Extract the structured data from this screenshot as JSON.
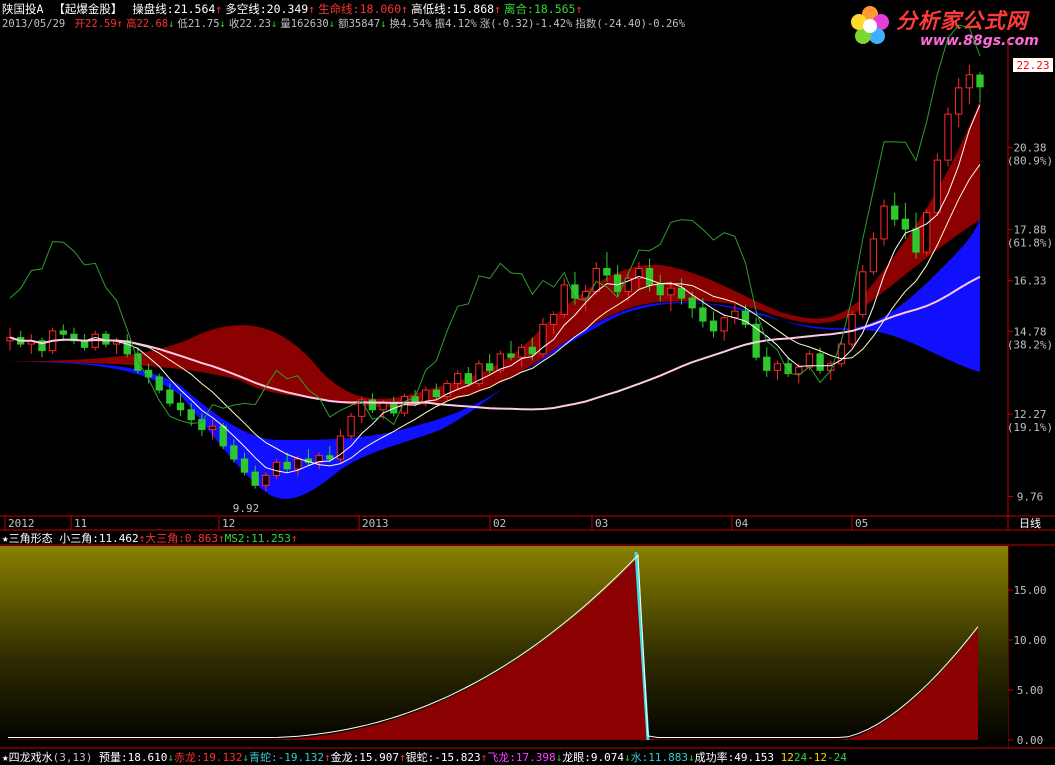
{
  "main_header": {
    "stock": "陕国投A",
    "formula": "【起爆金股】",
    "items": [
      {
        "label": "操盘线",
        "value": "21.564",
        "arrow": "↑",
        "color": "#ffffff"
      },
      {
        "label": "多空线",
        "value": "20.349",
        "arrow": "↑",
        "color": "#ffffff"
      },
      {
        "label": "生命线",
        "value": "18.060",
        "arrow": "↑",
        "color": "#ff3030"
      },
      {
        "label": "高低线",
        "value": "15.868",
        "arrow": "↑",
        "color": "#ffffff"
      },
      {
        "label": "离合",
        "value": "18.565",
        "arrow": "↑",
        "color": "#38d438"
      }
    ]
  },
  "quote_line": {
    "date": "2013/05/29",
    "items": [
      {
        "label": "开",
        "value": "22.59",
        "arrow": "↑",
        "color": "#ff3030"
      },
      {
        "label": "高",
        "value": "22.68",
        "arrow": "↓",
        "color": "#ff3030"
      },
      {
        "label": "低",
        "value": "21.75",
        "arrow": "↓",
        "color": "#c0c0c0"
      },
      {
        "label": "收",
        "value": "22.23",
        "arrow": "↓",
        "color": "#c0c0c0"
      },
      {
        "label": "量",
        "value": "162630",
        "arrow": "↓",
        "color": "#c0c0c0"
      },
      {
        "label": "额",
        "value": "35847",
        "arrow": "↓",
        "color": "#c0c0c0"
      },
      {
        "label": "换",
        "value": "4.54%",
        "arrow": "",
        "color": "#c0c0c0"
      },
      {
        "label": "振",
        "value": "4.12%",
        "arrow": "",
        "color": "#c0c0c0"
      },
      {
        "label": "涨",
        "value": "(-0.32)-1.42%",
        "arrow": "",
        "color": "#c0c0c0"
      },
      {
        "label": "指数",
        "value": "(-24.40)-0.26%",
        "arrow": "",
        "color": "#c0c0c0"
      }
    ]
  },
  "logo": {
    "title": "分析家公式网",
    "url": "www.88gs.com"
  },
  "price_axis": {
    "current": "22.23",
    "ticks": [
      {
        "value": "20.38",
        "pct": "(80.9%)"
      },
      {
        "value": "17.88",
        "pct": "(61.8%)"
      },
      {
        "value": "16.33",
        "pct": ""
      },
      {
        "value": "14.78",
        "pct": "(38.2%)"
      },
      {
        "value": "12.27",
        "pct": "(19.1%)"
      },
      {
        "value": "9.76",
        "pct": ""
      }
    ]
  },
  "low_label": "9.92",
  "date_axis": {
    "labels": [
      "2012",
      "11",
      "12",
      "2013",
      "02",
      "03",
      "04",
      "05"
    ],
    "period": "日线"
  },
  "sub1_header": {
    "title": "★三角形态",
    "items": [
      {
        "label": "小三角",
        "value": "11.462",
        "arrow": "↑",
        "color": "#ffffff"
      },
      {
        "label": "大三角",
        "value": "0.863",
        "arrow": "↑",
        "color": "#ff3030"
      },
      {
        "label": "MS2",
        "value": "11.253",
        "arrow": "↑",
        "color": "#38d438"
      }
    ],
    "ticks": [
      "15.00",
      "10.00",
      "5.00",
      "0.00"
    ]
  },
  "sub2_header": {
    "title": "★四龙戏水",
    "params": "(3,13)",
    "items": [
      {
        "label": "预量",
        "value": "18.610",
        "arrow": "↓",
        "color": "#ffffff"
      },
      {
        "label": "赤龙",
        "value": "19.132",
        "arrow": "↓",
        "color": "#ff3030"
      },
      {
        "label": "青蛇",
        "value": "-19.132",
        "arrow": "↑",
        "color": "#40c8c8"
      },
      {
        "label": "金龙",
        "value": "15.907",
        "arrow": "↑",
        "color": "#ffffff"
      },
      {
        "label": "银蛇",
        "value": "-15.823",
        "arrow": "↑",
        "color": "#ffffff"
      },
      {
        "label": "飞龙",
        "value": "17.398",
        "arrow": "↓",
        "color": "#ff40ff"
      },
      {
        "label": "龙眼",
        "value": "9.074",
        "arrow": "↓",
        "color": "#ffffff"
      },
      {
        "label": "水",
        "value": "11.883",
        "arrow": "↓",
        "color": "#40c8c8"
      },
      {
        "label": "成功率",
        "value": "49.153",
        "arrow": "",
        "color": "#ffffff"
      }
    ],
    "extra": [
      "12",
      "24",
      "-12",
      "-24"
    ]
  },
  "colors": {
    "up": "#ff2828",
    "down": "#2ec82e",
    "red_band": "#8b0000",
    "blue_band": "#1010ff",
    "axis": "#c00000",
    "pink_ma": "#ffc8e6",
    "green_line": "#2e9e2e",
    "yellow": "#ffd000"
  },
  "chart_data": {
    "type": "candlestick",
    "ylim": [
      9.5,
      23.2
    ],
    "dates": [
      "2012/10",
      "2012/11",
      "2012/12",
      "2013/01",
      "2013/02",
      "2013/03",
      "2013/04",
      "2013/05"
    ],
    "candles_ohlc": [
      [
        14.5,
        14.9,
        14.2,
        14.6
      ],
      [
        14.6,
        14.8,
        14.3,
        14.4
      ],
      [
        14.4,
        14.7,
        14.1,
        14.5
      ],
      [
        14.5,
        14.6,
        14.0,
        14.2
      ],
      [
        14.2,
        14.9,
        14.1,
        14.8
      ],
      [
        14.8,
        15.0,
        14.5,
        14.7
      ],
      [
        14.7,
        14.9,
        14.4,
        14.5
      ],
      [
        14.5,
        14.7,
        14.2,
        14.3
      ],
      [
        14.3,
        14.8,
        14.2,
        14.7
      ],
      [
        14.7,
        14.8,
        14.3,
        14.4
      ],
      [
        14.4,
        14.6,
        14.1,
        14.5
      ],
      [
        14.5,
        14.7,
        14.0,
        14.1
      ],
      [
        14.1,
        14.3,
        13.5,
        13.6
      ],
      [
        13.6,
        13.8,
        13.2,
        13.4
      ],
      [
        13.4,
        13.5,
        12.9,
        13.0
      ],
      [
        13.0,
        13.2,
        12.5,
        12.6
      ],
      [
        12.6,
        12.9,
        12.2,
        12.4
      ],
      [
        12.4,
        12.6,
        11.9,
        12.1
      ],
      [
        12.1,
        12.3,
        11.6,
        11.8
      ],
      [
        11.8,
        12.1,
        11.5,
        11.9
      ],
      [
        11.9,
        12.0,
        11.2,
        11.3
      ],
      [
        11.3,
        11.5,
        10.8,
        10.9
      ],
      [
        10.9,
        11.1,
        10.4,
        10.5
      ],
      [
        10.5,
        10.7,
        10.0,
        10.1
      ],
      [
        10.1,
        10.5,
        9.92,
        10.4
      ],
      [
        10.4,
        10.9,
        10.3,
        10.8
      ],
      [
        10.8,
        11.1,
        10.5,
        10.6
      ],
      [
        10.6,
        11.0,
        10.4,
        10.9
      ],
      [
        10.9,
        11.2,
        10.7,
        10.8
      ],
      [
        10.8,
        11.1,
        10.6,
        11.0
      ],
      [
        11.0,
        11.3,
        10.8,
        10.9
      ],
      [
        10.9,
        11.8,
        10.8,
        11.6
      ],
      [
        11.6,
        12.3,
        11.5,
        12.2
      ],
      [
        12.2,
        12.8,
        12.0,
        12.7
      ],
      [
        12.7,
        12.9,
        12.3,
        12.4
      ],
      [
        12.4,
        12.7,
        12.1,
        12.6
      ],
      [
        12.6,
        12.8,
        12.2,
        12.3
      ],
      [
        12.3,
        12.9,
        12.2,
        12.8
      ],
      [
        12.8,
        13.0,
        12.5,
        12.6
      ],
      [
        12.6,
        13.1,
        12.5,
        13.0
      ],
      [
        13.0,
        13.2,
        12.7,
        12.8
      ],
      [
        12.8,
        13.3,
        12.7,
        13.2
      ],
      [
        13.2,
        13.6,
        13.0,
        13.5
      ],
      [
        13.5,
        13.7,
        13.1,
        13.2
      ],
      [
        13.2,
        13.9,
        13.1,
        13.8
      ],
      [
        13.8,
        14.1,
        13.5,
        13.6
      ],
      [
        13.6,
        14.2,
        13.5,
        14.1
      ],
      [
        14.1,
        14.5,
        13.9,
        14.0
      ],
      [
        14.0,
        14.4,
        13.7,
        14.3
      ],
      [
        14.3,
        14.6,
        13.9,
        14.1
      ],
      [
        14.1,
        15.2,
        14.0,
        15.0
      ],
      [
        15.0,
        15.4,
        14.7,
        15.3
      ],
      [
        15.3,
        16.4,
        15.2,
        16.2
      ],
      [
        16.2,
        16.6,
        15.6,
        15.8
      ],
      [
        15.8,
        16.2,
        15.4,
        16.0
      ],
      [
        16.0,
        16.9,
        15.9,
        16.7
      ],
      [
        16.7,
        17.2,
        16.3,
        16.5
      ],
      [
        16.5,
        16.8,
        15.8,
        16.0
      ],
      [
        16.0,
        16.6,
        15.7,
        16.4
      ],
      [
        16.4,
        16.9,
        16.1,
        16.7
      ],
      [
        16.7,
        17.0,
        16.0,
        16.2
      ],
      [
        16.2,
        16.5,
        15.7,
        15.9
      ],
      [
        15.9,
        16.3,
        15.4,
        16.1
      ],
      [
        16.1,
        16.4,
        15.6,
        15.8
      ],
      [
        15.8,
        16.0,
        15.2,
        15.5
      ],
      [
        15.5,
        15.8,
        14.9,
        15.1
      ],
      [
        15.1,
        15.4,
        14.6,
        14.8
      ],
      [
        14.8,
        15.3,
        14.5,
        15.2
      ],
      [
        15.2,
        15.6,
        15.0,
        15.4
      ],
      [
        15.4,
        15.6,
        14.9,
        15.0
      ],
      [
        15.0,
        15.2,
        13.9,
        14.0
      ],
      [
        14.0,
        14.3,
        13.4,
        13.6
      ],
      [
        13.6,
        13.9,
        13.3,
        13.8
      ],
      [
        13.8,
        14.0,
        13.4,
        13.5
      ],
      [
        13.5,
        13.8,
        13.2,
        13.7
      ],
      [
        13.7,
        14.2,
        13.6,
        14.1
      ],
      [
        14.1,
        14.3,
        13.5,
        13.6
      ],
      [
        13.6,
        13.9,
        13.3,
        13.8
      ],
      [
        13.8,
        14.5,
        13.7,
        14.4
      ],
      [
        14.4,
        15.4,
        14.3,
        15.3
      ],
      [
        15.3,
        16.8,
        15.2,
        16.6
      ],
      [
        16.6,
        17.8,
        16.5,
        17.6
      ],
      [
        17.6,
        18.8,
        17.4,
        18.6
      ],
      [
        18.6,
        19.0,
        18.0,
        18.2
      ],
      [
        18.2,
        18.7,
        17.6,
        17.9
      ],
      [
        17.9,
        18.4,
        17.0,
        17.2
      ],
      [
        17.2,
        18.5,
        17.1,
        18.4
      ],
      [
        18.4,
        20.2,
        18.3,
        20.0
      ],
      [
        20.0,
        21.6,
        19.8,
        21.4
      ],
      [
        21.4,
        22.5,
        21.0,
        22.2
      ],
      [
        22.2,
        22.9,
        21.7,
        22.6
      ],
      [
        22.59,
        22.68,
        21.75,
        22.23
      ]
    ]
  }
}
